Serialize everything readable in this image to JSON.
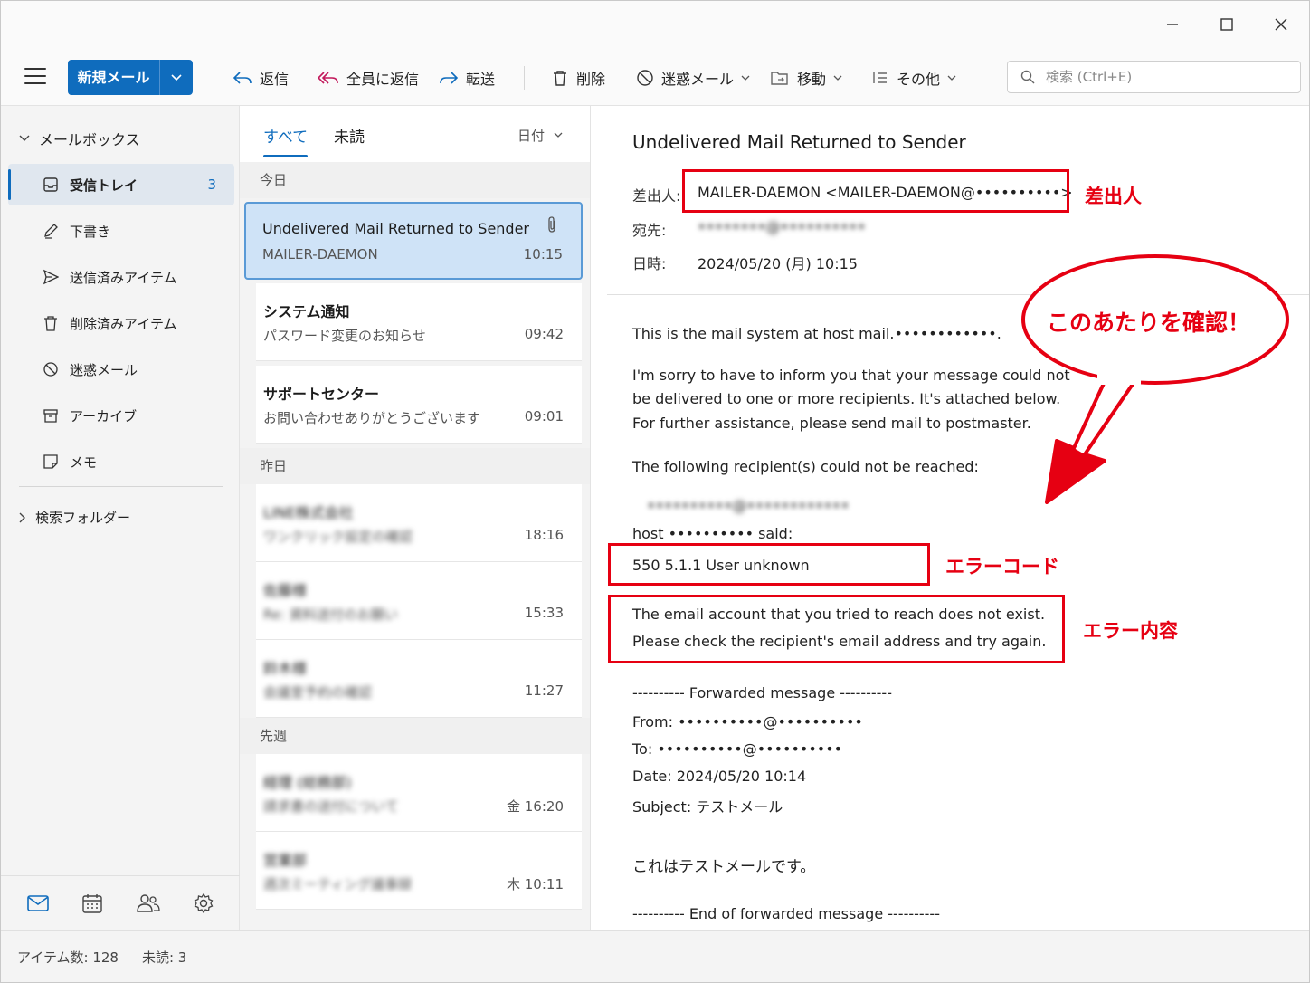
{
  "toolbar": {
    "new_mail": "新規メール",
    "reply": "返信",
    "reply_all": "全員に返信",
    "forward": "転送",
    "delete": "削除",
    "junk": "迷惑メール",
    "move": "移動",
    "more": "その他",
    "search_placeholder": "検索 (Ctrl+E)"
  },
  "sidebar": {
    "mailbox_label": "メールボックス",
    "items": [
      {
        "label": "受信トレイ",
        "count": "3",
        "icon": "inbox-icon"
      },
      {
        "label": "下書き",
        "icon": "draft-icon"
      },
      {
        "label": "送信済みアイテム",
        "icon": "send-icon"
      },
      {
        "label": "削除済みアイテム",
        "icon": "trash-icon"
      },
      {
        "label": "迷惑メール",
        "icon": "block-icon"
      },
      {
        "label": "アーカイブ",
        "icon": "archive-icon"
      },
      {
        "label": "メモ",
        "icon": "note-icon"
      }
    ],
    "search_folder_label": "検索フォルダー"
  },
  "message_list": {
    "tabs": [
      "すべて",
      "未読"
    ],
    "sort_label": "日付",
    "groups": [
      "今日",
      "昨日",
      "先週"
    ],
    "items": [
      {
        "subject": "Undelivered Mail Returned to Sender",
        "sender": "MAILER-DAEMON",
        "time": "10:15"
      },
      {
        "subject": "システム通知",
        "sender": "パスワード変更のお知らせ",
        "time": "09:42"
      },
      {
        "subject": "サポートセンター",
        "sender": "お問い合わせありがとうございます",
        "time": "09:01"
      },
      {
        "subject": "LINE株式会社",
        "sender": "ワンクリック設定の確認",
        "time": "18:16"
      },
      {
        "subject": "佐藤様",
        "sender": "Re: 資料送付のお願い",
        "time": "15:33"
      },
      {
        "subject": "鈴木様",
        "sender": "会議室予約の確認",
        "time": "11:27"
      },
      {
        "subject": "経理 (総務部)",
        "sender": "請求書の送付について",
        "time": "金 16:20"
      },
      {
        "subject": "営業部",
        "sender": "週次ミーティング議事録",
        "time": "木 10:11"
      }
    ]
  },
  "reading_pane": {
    "title": "Undelivered Mail Returned to Sender",
    "from_label": "差出人:",
    "from_value": "MAILER-DAEMON <MAILER-DAEMON@••••••••••>",
    "to_label": "宛先:",
    "to_value": "••••••••@••••••••••",
    "date_label": "日時:",
    "date_value": "2024/05/20 (月) 10:15",
    "body": {
      "line1": "This is the mail system at host mail.••••••••••••.",
      "line2": "I'm sorry to have to inform you that your message could not",
      "line3": "be delivered to one or more recipients. It's attached below.",
      "line4": "For further assistance, please send mail to postmaster.",
      "line5": "The following recipient(s) could not be reached:",
      "recipient": "••••••••••@••••••••••••",
      "host_said": "host •••••••••• said:",
      "error_code": "550 5.1.1 User unknown",
      "error_line1": "The email account that you tried to reach does not exist.",
      "error_line2": "Please check the recipient's email address and try again.",
      "fwd_start": "---------- Forwarded message ----------",
      "fwd_from": "From: ••••••••••@••••••••••",
      "fwd_to": "To: ••••••••••@••••••••••",
      "fwd_date": "Date: 2024/05/20 10:14",
      "fwd_subject": "Subject: テストメール",
      "fwd_body": "これはテストメールです。",
      "fwd_end": "---------- End of forwarded message ----------"
    }
  },
  "annotations": {
    "sender": "差出人",
    "check_here": "このあたりを確認！",
    "error_code": "エラーコード",
    "error_content": "エラー内容"
  },
  "status_bar": {
    "items_count": "アイテム数: 128",
    "unread_count": "未読: 3"
  },
  "colors": {
    "accent": "#0f6cbd",
    "annotation": "#e60012"
  }
}
